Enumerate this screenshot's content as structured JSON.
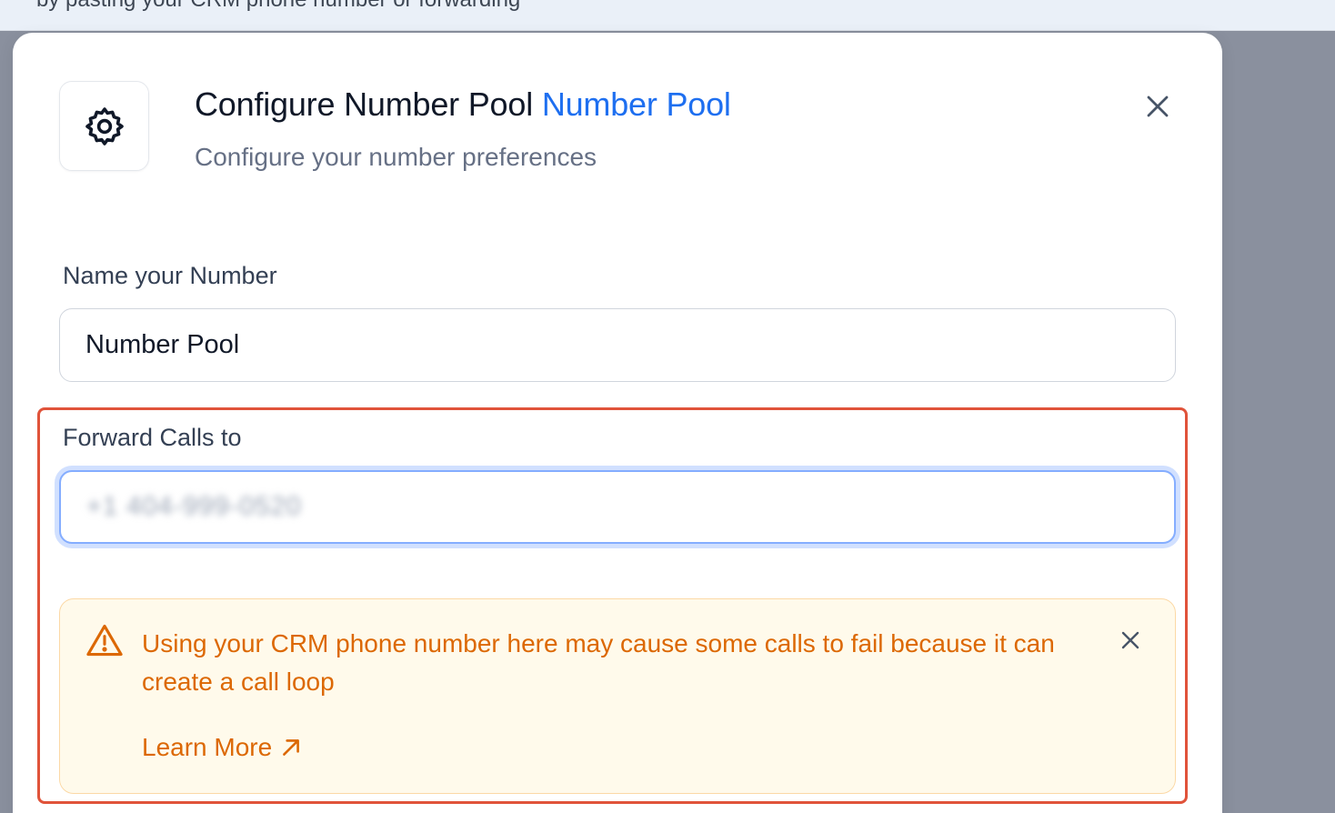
{
  "background_strip": {
    "cut_text": "by pasting your CRM phone number or forwarding"
  },
  "modal": {
    "title": "Configure Number Pool",
    "title_accent": "Number Pool",
    "subtitle": "Configure your number preferences",
    "header_icon": "gear-icon",
    "close_icon": "close-icon"
  },
  "fields": {
    "name": {
      "label": "Name your Number",
      "value": "Number Pool"
    },
    "forward": {
      "label": "Forward Calls to",
      "value": "+1 404-999-0520"
    }
  },
  "alert": {
    "icon": "warning-triangle-icon",
    "message": "Using your CRM phone number here may cause some calls to fail because it can create a call loop",
    "link_label": "Learn More",
    "link_icon": "arrow-up-right-icon",
    "close_icon": "close-icon"
  },
  "colors": {
    "accent": "#1e6ff0",
    "warning": "#dc6803",
    "warning_bg": "#fffaeb",
    "highlight_border": "#e0533a"
  }
}
